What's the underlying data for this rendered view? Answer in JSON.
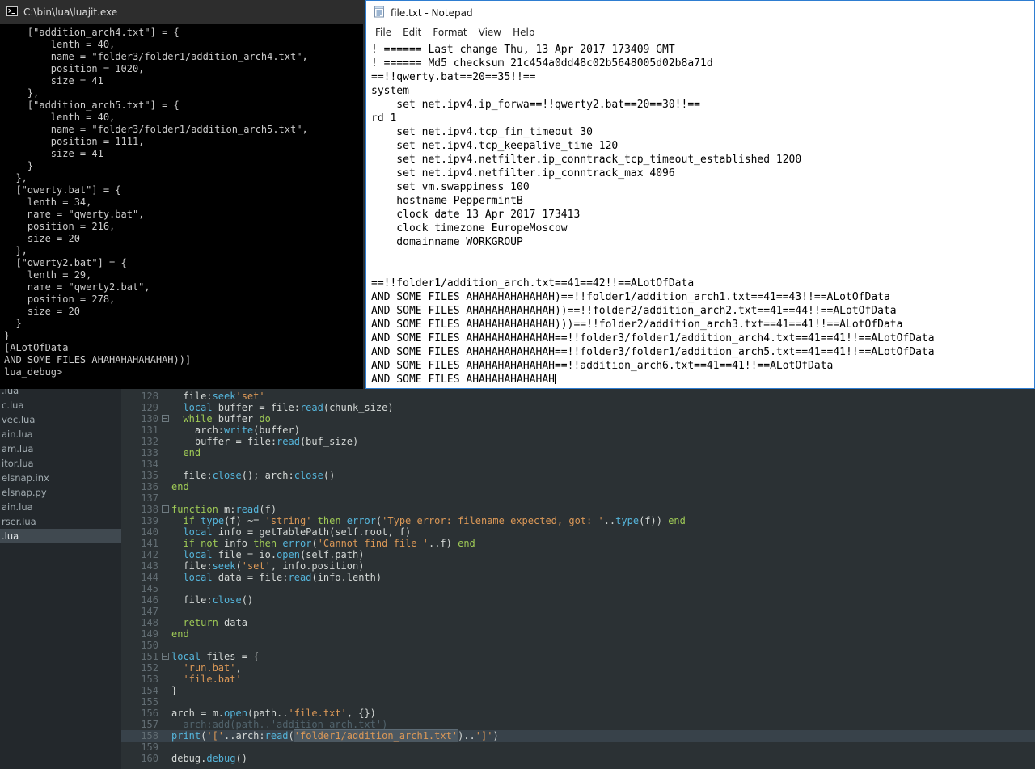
{
  "console": {
    "title": "C:\\bin\\lua\\luajit.exe",
    "lines": [
      "    [\"addition_arch4.txt\"] = {",
      "        lenth = 40,",
      "        name = \"folder3/folder1/addition_arch4.txt\",",
      "        position = 1020,",
      "        size = 41",
      "    },",
      "    [\"addition_arch5.txt\"] = {",
      "        lenth = 40,",
      "        name = \"folder3/folder1/addition_arch5.txt\",",
      "        position = 1111,",
      "        size = 41",
      "    }",
      "  },",
      "  [\"qwerty.bat\"] = {",
      "    lenth = 34,",
      "    name = \"qwerty.bat\",",
      "    position = 216,",
      "    size = 20",
      "  },",
      "  [\"qwerty2.bat\"] = {",
      "    lenth = 29,",
      "    name = \"qwerty2.bat\",",
      "    position = 278,",
      "    size = 20",
      "  }",
      "}",
      "[ALotOfData",
      "AND SOME FILES AHAHAHAHAHAHAH))]",
      "lua_debug>"
    ]
  },
  "notepad": {
    "title": "file.txt - Notepad",
    "menu": [
      "File",
      "Edit",
      "Format",
      "View",
      "Help"
    ],
    "lines": [
      "! ====== Last change Thu, 13 Apr 2017 173409 GMT",
      "! ====== Md5 checksum 21c454a0dd48c02b5648005d02b8a71d",
      "==!!qwerty.bat==20==35!!==",
      "system",
      "    set net.ipv4.ip_forwa==!!qwerty2.bat==20==30!!==",
      "rd 1",
      "    set net.ipv4.tcp_fin_timeout 30",
      "    set net.ipv4.tcp_keepalive_time 120",
      "    set net.ipv4.netfilter.ip_conntrack_tcp_timeout_established 1200",
      "    set net.ipv4.netfilter.ip_conntrack_max 4096",
      "    set vm.swappiness 100",
      "    hostname PeppermintB",
      "    clock date 13 Apr 2017 173413",
      "    clock timezone EuropeMoscow",
      "    domainname WORKGROUP",
      "",
      "",
      "==!!folder1/addition_arch.txt==41==42!!==ALotOfData",
      "AND SOME FILES AHAHAHAHAHAHAH)==!!folder1/addition_arch1.txt==41==43!!==ALotOfData",
      "AND SOME FILES AHAHAHAHAHAHAH))==!!folder2/addition_arch2.txt==41==44!!==ALotOfData",
      "AND SOME FILES AHAHAHAHAHAHAH)))==!!folder2/addition_arch3.txt==41==41!!==ALotOfData",
      "AND SOME FILES AHAHAHAHAHAHAH==!!folder3/folder1/addition_arch4.txt==41==41!!==ALotOfData",
      "AND SOME FILES AHAHAHAHAHAHAH==!!folder3/folder1/addition_arch5.txt==41==41!!==ALotOfData",
      "AND SOME FILES AHAHAHAHAHAHAH==!!addition_arch6.txt==41==41!!==ALotOfData",
      "AND SOME FILES AHAHAHAHAHAHAH"
    ]
  },
  "editor": {
    "theme": {
      "background": "#2b3134",
      "sidebar_background": "#23282c",
      "keyword": "#9fca56",
      "builtin": "#55b5db",
      "string": "#db9857",
      "comment": "#51636c",
      "selection": "#4c5861",
      "notepad_border": "#2e7dd1"
    },
    "sidebar": {
      "files": [
        ".lua",
        "c.lua",
        "vec.lua",
        "ain.lua",
        "am.lua",
        "itor.lua",
        "elsnap.inx",
        "elsnap.py",
        "ain.lua",
        "rser.lua",
        ".lua"
      ],
      "selected_index": 10
    },
    "code": [
      {
        "n": 128,
        "t": [
          [
            "p",
            "  file:"
          ],
          [
            "b",
            "seek"
          ],
          [
            "s",
            "'set'"
          ]
        ]
      },
      {
        "n": 129,
        "t": [
          [
            "p",
            "  "
          ],
          [
            "b",
            "local"
          ],
          [
            "p",
            " buffer = file:"
          ],
          [
            "b",
            "read"
          ],
          [
            "p",
            "(chunk_size)"
          ]
        ]
      },
      {
        "n": 130,
        "fold": true,
        "t": [
          [
            "p",
            "  "
          ],
          [
            "k",
            "while"
          ],
          [
            "p",
            " buffer "
          ],
          [
            "k",
            "do"
          ]
        ]
      },
      {
        "n": 131,
        "t": [
          [
            "p",
            "    arch:"
          ],
          [
            "b",
            "write"
          ],
          [
            "p",
            "(buffer)"
          ]
        ]
      },
      {
        "n": 132,
        "t": [
          [
            "p",
            "    buffer = file:"
          ],
          [
            "b",
            "read"
          ],
          [
            "p",
            "(buf_size)"
          ]
        ]
      },
      {
        "n": 133,
        "t": [
          [
            "p",
            "  "
          ],
          [
            "k",
            "end"
          ]
        ]
      },
      {
        "n": 134,
        "t": []
      },
      {
        "n": 135,
        "t": [
          [
            "p",
            "  file:"
          ],
          [
            "b",
            "close"
          ],
          [
            "p",
            "(); arch:"
          ],
          [
            "b",
            "close"
          ],
          [
            "p",
            "()"
          ]
        ]
      },
      {
        "n": 136,
        "t": [
          [
            "k",
            "end"
          ]
        ]
      },
      {
        "n": 137,
        "t": []
      },
      {
        "n": 138,
        "fold": true,
        "t": [
          [
            "k",
            "function"
          ],
          [
            "p",
            " m:"
          ],
          [
            "b",
            "read"
          ],
          [
            "p",
            "(f)"
          ]
        ]
      },
      {
        "n": 139,
        "t": [
          [
            "p",
            "  "
          ],
          [
            "k",
            "if"
          ],
          [
            "p",
            " "
          ],
          [
            "b",
            "type"
          ],
          [
            "p",
            "(f) ~= "
          ],
          [
            "s",
            "'string'"
          ],
          [
            "p",
            " "
          ],
          [
            "k",
            "then"
          ],
          [
            "p",
            " "
          ],
          [
            "b",
            "error"
          ],
          [
            "p",
            "("
          ],
          [
            "s",
            "'Type error: filename expected, got: '"
          ],
          [
            "p",
            ".."
          ],
          [
            "b",
            "type"
          ],
          [
            "p",
            "(f)) "
          ],
          [
            "k",
            "end"
          ]
        ]
      },
      {
        "n": 140,
        "t": [
          [
            "p",
            "  "
          ],
          [
            "b",
            "local"
          ],
          [
            "p",
            " info = getTablePath(self.root, f)"
          ]
        ]
      },
      {
        "n": 141,
        "t": [
          [
            "p",
            "  "
          ],
          [
            "k",
            "if"
          ],
          [
            "p",
            " "
          ],
          [
            "k",
            "not"
          ],
          [
            "p",
            " info "
          ],
          [
            "k",
            "then"
          ],
          [
            "p",
            " "
          ],
          [
            "b",
            "error"
          ],
          [
            "p",
            "("
          ],
          [
            "s",
            "'Cannot find file '"
          ],
          [
            "p",
            "..f) "
          ],
          [
            "k",
            "end"
          ]
        ]
      },
      {
        "n": 142,
        "t": [
          [
            "p",
            "  "
          ],
          [
            "b",
            "local"
          ],
          [
            "p",
            " file = io."
          ],
          [
            "b",
            "open"
          ],
          [
            "p",
            "(self.path)"
          ]
        ]
      },
      {
        "n": 143,
        "t": [
          [
            "p",
            "  file:"
          ],
          [
            "b",
            "seek"
          ],
          [
            "p",
            "("
          ],
          [
            "s",
            "'set'"
          ],
          [
            "p",
            ", info.position)"
          ]
        ]
      },
      {
        "n": 144,
        "t": [
          [
            "p",
            "  "
          ],
          [
            "b",
            "local"
          ],
          [
            "p",
            " data = file:"
          ],
          [
            "b",
            "read"
          ],
          [
            "p",
            "(info.lenth)"
          ]
        ]
      },
      {
        "n": 145,
        "t": []
      },
      {
        "n": 146,
        "t": [
          [
            "p",
            "  file:"
          ],
          [
            "b",
            "close"
          ],
          [
            "p",
            "()"
          ]
        ]
      },
      {
        "n": 147,
        "t": []
      },
      {
        "n": 148,
        "t": [
          [
            "p",
            "  "
          ],
          [
            "k",
            "return"
          ],
          [
            "p",
            " data"
          ]
        ]
      },
      {
        "n": 149,
        "t": [
          [
            "k",
            "end"
          ]
        ]
      },
      {
        "n": 150,
        "t": []
      },
      {
        "n": 151,
        "fold": true,
        "t": [
          [
            "b",
            "local"
          ],
          [
            "p",
            " files = {"
          ]
        ]
      },
      {
        "n": 152,
        "t": [
          [
            "p",
            "  "
          ],
          [
            "s",
            "'run.bat'"
          ],
          [
            "p",
            ","
          ]
        ]
      },
      {
        "n": 153,
        "t": [
          [
            "p",
            "  "
          ],
          [
            "s",
            "'file.bat'"
          ]
        ]
      },
      {
        "n": 154,
        "t": [
          [
            "p",
            "}"
          ]
        ]
      },
      {
        "n": 155,
        "t": []
      },
      {
        "n": 156,
        "t": [
          [
            "p",
            "arch = m."
          ],
          [
            "b",
            "open"
          ],
          [
            "p",
            "(path.."
          ],
          [
            "s",
            "'file.txt'"
          ],
          [
            "p",
            ", {})"
          ]
        ]
      },
      {
        "n": 157,
        "t": [
          [
            "c",
            "--arch:add(path..'addition_arch.txt')"
          ]
        ]
      },
      {
        "n": 158,
        "hl": true,
        "t": [
          [
            "b",
            "print"
          ],
          [
            "p",
            "("
          ],
          [
            "s",
            "'['"
          ],
          [
            "p",
            "..arch:"
          ],
          [
            "b",
            "read"
          ],
          [
            "p",
            "("
          ],
          [
            "x",
            "'folder1/addition_arch1.txt'"
          ],
          [
            "p",
            ").."
          ],
          [
            "s",
            "']'"
          ],
          [
            "p",
            ")"
          ]
        ]
      },
      {
        "n": 159,
        "t": []
      },
      {
        "n": 160,
        "t": [
          [
            "p",
            "debug."
          ],
          [
            "b",
            "debug"
          ],
          [
            "p",
            "()"
          ]
        ]
      }
    ]
  }
}
